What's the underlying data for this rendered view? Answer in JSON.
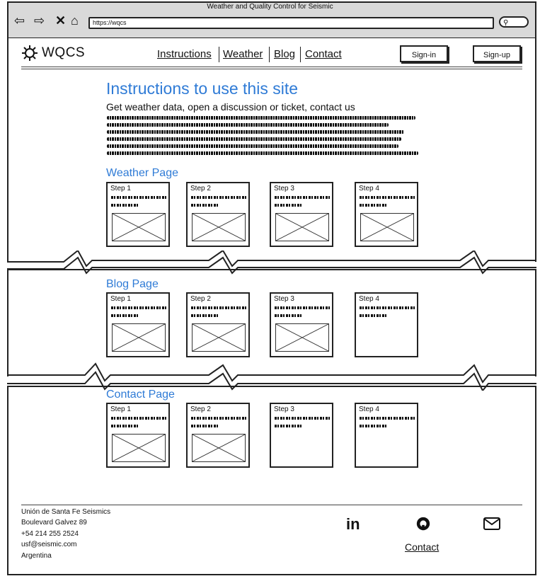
{
  "window": {
    "title": "Weather and Quality Control for Seismic",
    "url": "https://wqcs"
  },
  "brand": {
    "name": "WQCS"
  },
  "nav": {
    "instructions": "Instructions",
    "weather": "Weather",
    "blog": "Blog",
    "contact": "Contact"
  },
  "auth": {
    "signin": "Sign-in",
    "signup": "Sign-up"
  },
  "main": {
    "title": "Instructions to use this site",
    "subtitle": "Get weather data, open a discussion or ticket, contact us"
  },
  "sections": [
    {
      "title": "Weather Page",
      "steps": [
        "Step 1",
        "Step 2",
        "Step 3",
        "Step 4"
      ]
    },
    {
      "title": "Blog Page",
      "steps": [
        "Step 1",
        "Step 2",
        "Step 3",
        "Step 4"
      ]
    },
    {
      "title": "Contact Page",
      "steps": [
        "Step 1",
        "Step 2",
        "Step 3",
        "Step 4"
      ]
    }
  ],
  "footer": {
    "org": "Unión de Santa Fe Seismics",
    "address": "Boulevard Galvez 89",
    "phone": "+54 214 255 2524",
    "email": "usf@seismic.com",
    "country": "Argentina",
    "contact_link": "Contact"
  },
  "icons": {
    "linkedin": "linkedin-icon",
    "github": "github-icon",
    "mail": "mail-icon"
  },
  "colors": {
    "accent": "#2f7bd6",
    "chrome": "#d9d9d9"
  }
}
